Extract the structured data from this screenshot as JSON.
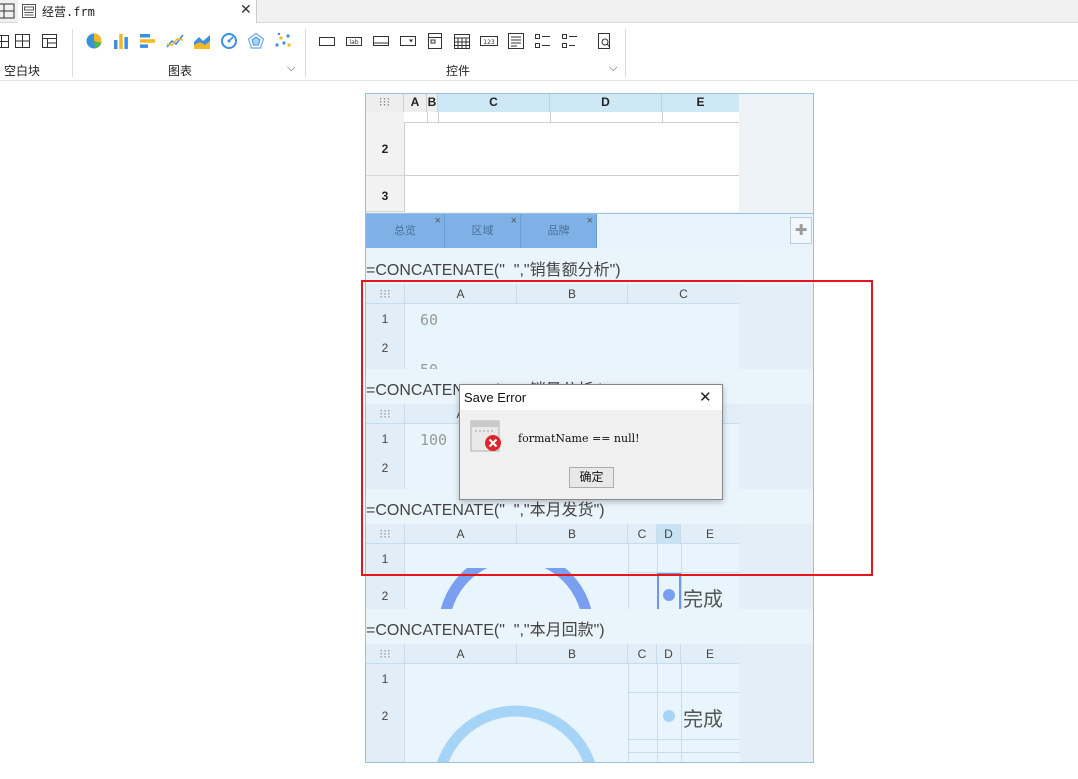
{
  "tab": {
    "title": "经营.frm"
  },
  "toolbar": {
    "groups": [
      {
        "label": "空白块"
      },
      {
        "label": "图表",
        "dropdown": true
      },
      {
        "label": "控件",
        "dropdown": true
      }
    ],
    "icons": {
      "blank": [
        "absolute-layout-icon",
        "grid-layout-icon",
        "table-layout-icon"
      ],
      "charts": [
        "pie-chart-icon",
        "bar-chart-icon",
        "horizontal-bar-chart-icon",
        "line-chart-icon",
        "area-chart-icon",
        "gauge-chart-icon",
        "radar-chart-icon",
        "scatter-chart-icon"
      ],
      "widgets": [
        "text-box-icon",
        "label-icon",
        "button-icon",
        "combo-box-icon",
        "date-picker-icon",
        "calendar-icon",
        "number-field-icon",
        "list-icon",
        "checkbox-group-icon",
        "radio-group-icon",
        "search-icon"
      ]
    }
  },
  "grid_top": {
    "columns": [
      "A",
      "B",
      "C",
      "D",
      "E"
    ],
    "rows": [
      "2",
      "3"
    ]
  },
  "tabs_widget": {
    "tabs": [
      "总览",
      "区域",
      "品牌"
    ],
    "close_glyph": "×",
    "add_glyph": "✚"
  },
  "sections": [
    {
      "formula": "=CONCATENATE(\"  \",\"销售额分析\")",
      "columns": [
        "A",
        "B",
        "C"
      ],
      "rows": [
        "1",
        "2"
      ],
      "value": "60",
      "cut_value": "50"
    },
    {
      "formula": "=CONCATENATE(\"  \",\"销量分析\")",
      "columns": [
        "A"
      ],
      "rows": [
        "1",
        "2"
      ],
      "value": "100"
    },
    {
      "formula": "=CONCATENATE(\"  \",\"本月发货\")",
      "columns": [
        "A",
        "B",
        "C",
        "D",
        "E"
      ],
      "rows": [
        "1",
        "2"
      ],
      "status": "完成"
    },
    {
      "formula": "=CONCATENATE(\"  \",\"本月回款\")",
      "columns": [
        "A",
        "B",
        "C",
        "D",
        "E"
      ],
      "rows": [
        "1",
        "2"
      ],
      "status": "完成"
    }
  ],
  "dialog": {
    "title": "Save Error",
    "message": "formatName == null!",
    "ok_label": "确定",
    "close_glyph": "✕"
  },
  "colors": {
    "selection": "#e8141c",
    "tab_bg": "#7fb1e6",
    "header_bg": "#cfe8f6",
    "canvas_bg": "#eaf4fb",
    "gauge_blue": "#7a9ef0",
    "gauge_light": "#a6d4f7",
    "error_red": "#e0262b"
  }
}
